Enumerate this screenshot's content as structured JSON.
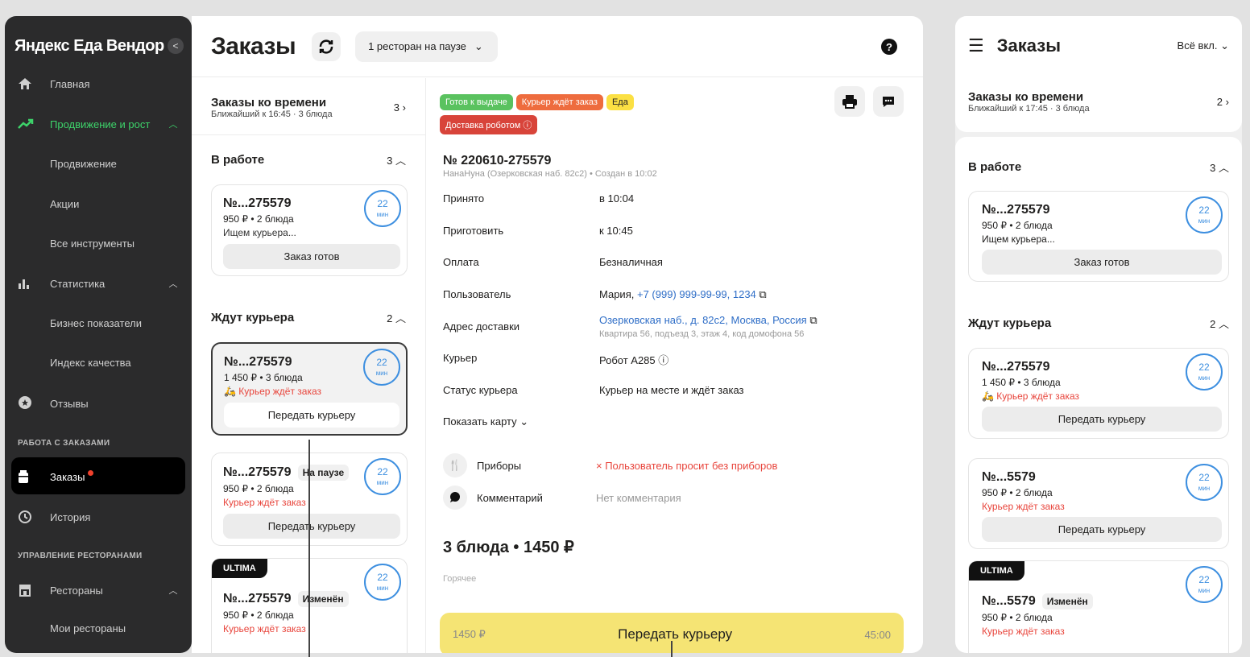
{
  "sidebar": {
    "title": "Яндекс Еда Вендор",
    "collapse": "<",
    "items": [
      {
        "label": "Главная",
        "caret": ""
      },
      {
        "label": "Продвижение и рост",
        "caret": "^"
      },
      {
        "label": "Статистика",
        "caret": "^"
      },
      {
        "label": "Отзывы",
        "caret": ""
      },
      {
        "label": "Заказы",
        "caret": ""
      },
      {
        "label": "История",
        "caret": ""
      },
      {
        "label": "Рестораны",
        "caret": "^"
      }
    ],
    "sub": {
      "promo": "Продвижение",
      "actions": "Акции",
      "tools": "Все инструменты",
      "biz": "Бизнес показатели",
      "quality": "Индекс качества",
      "myrest": "Мои рестораны"
    },
    "sections": {
      "orders": "РАБОТА С ЗАКАЗАМИ",
      "rest": "УПРАВЛЕНИЕ РЕСТОРАНАМИ"
    },
    "accent": "#3dd36a"
  },
  "header": {
    "title": "Заказы",
    "pause": "1 ресторан на паузе",
    "help": "?"
  },
  "list": {
    "timed": {
      "title": "Заказы ко времени",
      "sub": "Ближайший к 16:45 · 3 блюда",
      "count": "3"
    },
    "work": {
      "title": "В работе",
      "count": "3"
    },
    "wait": {
      "title": "Ждут курьера",
      "count": "2"
    },
    "cards": [
      {
        "num": "№...275579",
        "meta": "950 ₽ • 2 блюда",
        "st": "Ищем курьера...",
        "btn": "Заказ готов",
        "min": "22",
        "unit": "мин"
      },
      {
        "num": "№...275579",
        "meta": "1 450 ₽ • 3 блюда",
        "st": "Курьер ждёт заказ",
        "btn": "Передать курьеру",
        "min": "22",
        "unit": "мин"
      },
      {
        "num": "№...275579",
        "badge": "На паузе",
        "meta": "950 ₽ • 2 блюда",
        "st": "Курьер ждёт заказ",
        "btn": "Передать курьеру",
        "min": "22",
        "unit": "мин"
      },
      {
        "num": "№...275579",
        "badge": "Изменён",
        "ultima": "ULTIMA",
        "meta": "950 ₽ • 2 блюда",
        "st": "Курьер ждёт заказ",
        "min": "22",
        "unit": "мин"
      }
    ]
  },
  "detail": {
    "tags": [
      "Готов к выдаче",
      "Курьер ждёт заказ",
      "Еда",
      "Доставка роботом ⓘ"
    ],
    "order_no": "№ 220610-275579",
    "order_sub": "НанаНуна (Озерковская наб. 82с2) • Создан в 10:02",
    "rows": [
      {
        "k": "Принято",
        "v": "в 10:04"
      },
      {
        "k": "Приготовить",
        "v": "к 10:45"
      },
      {
        "k": "Оплата",
        "v": "Безналичная"
      },
      {
        "k": "Пользователь",
        "v": "Мария,",
        "link": "+7 (999) 999-99-99, 1234"
      },
      {
        "k": "Адрес доставки",
        "link": "Озерковская наб., д. 82с2, Москва, Россия",
        "sub": "Квартира 56, подъезд 3, этаж 4, код домофона 56"
      },
      {
        "k": "Курьер",
        "v": "Робот А285 ⓘ"
      },
      {
        "k": "Статус курьера",
        "v": "Курьер на месте и ждёт заказ"
      },
      {
        "k": "Показать карту ⌄"
      },
      {
        "k": "Приборы",
        "v": "× Пользователь просит без приборов"
      },
      {
        "k": "Комментарий",
        "v": "Нет комментария"
      }
    ],
    "dishes": "3 блюда • 1450 ₽",
    "hot": "Горячее",
    "action": {
      "price": "1450 ₽",
      "label": "Передать курьеру",
      "time": "45:00"
    }
  },
  "mobile": {
    "title": "Заказы",
    "filter": "Всё вкл. ⌄",
    "timed": {
      "title": "Заказы ко времени",
      "sub": "Ближайший к 17:45 · 3 блюда",
      "count": "2"
    },
    "work": {
      "title": "В работе",
      "count": "3"
    },
    "wait": {
      "title": "Ждут курьера",
      "count": "2"
    },
    "cards": [
      {
        "num": "№...275579",
        "meta": "950 ₽ • 2 блюда",
        "st": "Ищем курьера...",
        "btn": "Заказ готов",
        "min": "22",
        "unit": "мин"
      },
      {
        "num": "№...275579",
        "meta": "1 450 ₽ • 3 блюда",
        "st": "Курьер ждёт заказ",
        "btn": "Передать курьеру",
        "min": "22",
        "unit": "мин"
      },
      {
        "num": "№...5579",
        "meta": "950 ₽ • 2 блюда",
        "st": "Курьер ждёт заказ",
        "btn": "Передать курьеру",
        "min": "22",
        "unit": "мин"
      },
      {
        "num": "№...5579",
        "badge": "Изменён",
        "ultima": "ULTIMA",
        "meta": "950 ₽ • 2 блюда",
        "st": "Курьер ждёт заказ",
        "min": "22",
        "unit": "мин"
      }
    ]
  }
}
